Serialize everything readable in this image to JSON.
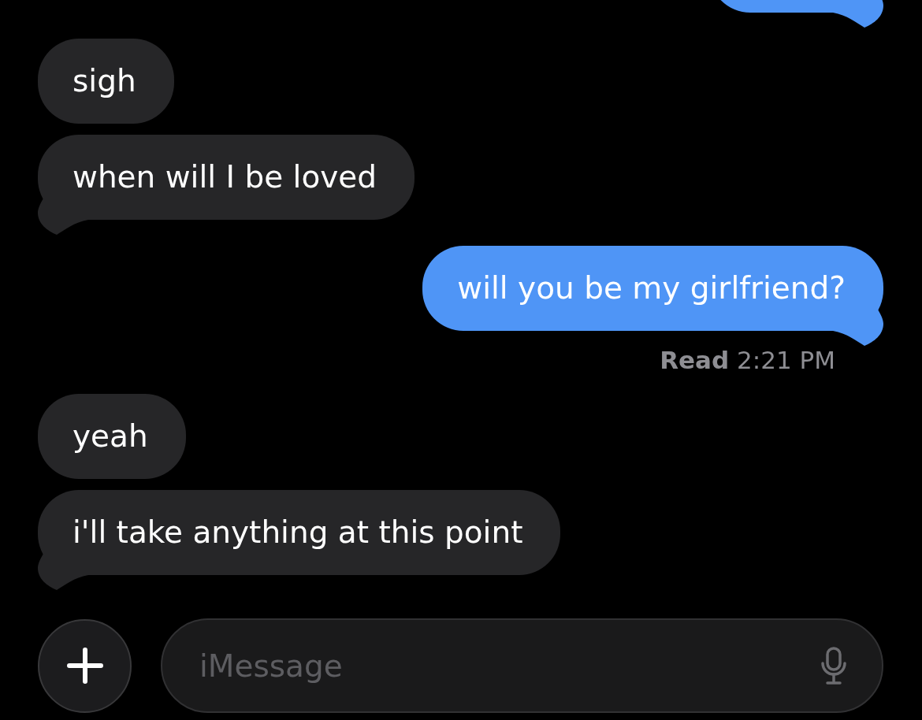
{
  "messages": [
    {
      "kind": "sent",
      "tail": true,
      "clipped": true
    },
    {
      "kind": "received",
      "text": "sigh",
      "tail": false,
      "clipped": false
    },
    {
      "kind": "received",
      "text": "when will I be loved",
      "tail": true,
      "clipped": false
    },
    {
      "kind": "sent",
      "text": "will you be my girlfriend?",
      "tail": true,
      "clipped": false,
      "receipt": "**Read** 2:21 PM"
    },
    {
      "kind": "received",
      "text": "yeah",
      "tail": false,
      "clipped": false
    },
    {
      "kind": "received",
      "text": "i'll take anything at this point",
      "tail": true,
      "clipped": false
    }
  ],
  "composer": {
    "placeholder": "iMessage"
  }
}
